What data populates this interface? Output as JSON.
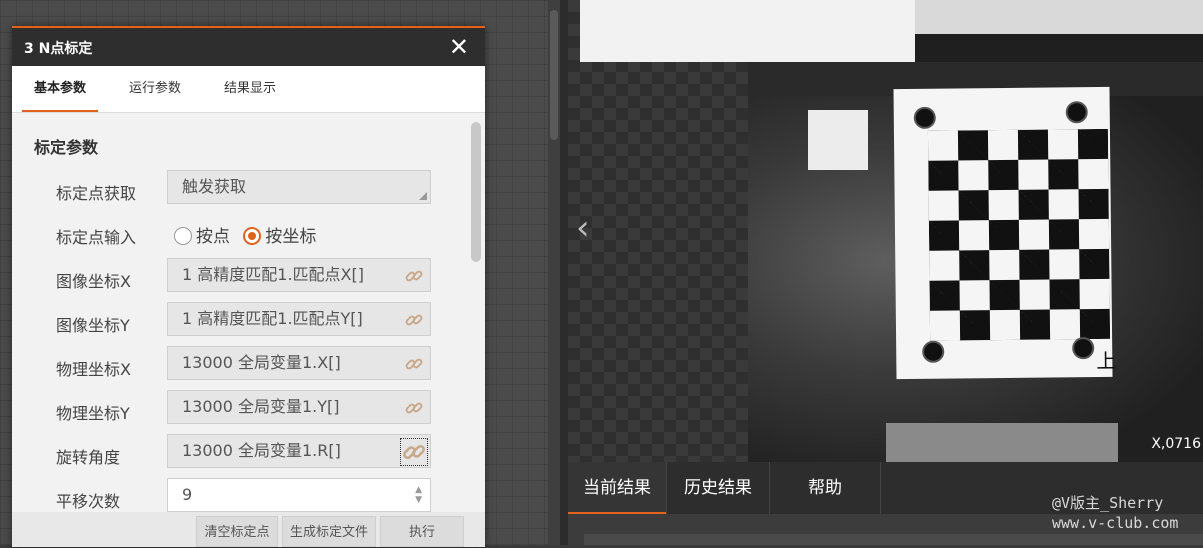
{
  "dialog": {
    "title": "3 N点标定",
    "close_glyph": "✕",
    "tabs": [
      {
        "label": "基本参数",
        "active": true
      },
      {
        "label": "运行参数",
        "active": false
      },
      {
        "label": "结果显示",
        "active": false
      }
    ],
    "section_title": "标定参数",
    "fields": {
      "acquire": {
        "label": "标定点获取",
        "value": "触发获取"
      },
      "input": {
        "label": "标定点输入",
        "options": [
          "按点",
          "按坐标"
        ],
        "selected": "按坐标"
      },
      "image_x": {
        "label": "图像坐标X",
        "value": "1 高精度匹配1.匹配点X[]"
      },
      "image_y": {
        "label": "图像坐标Y",
        "value": "1 高精度匹配1.匹配点Y[]"
      },
      "phys_x": {
        "label": "物理坐标X",
        "value": "13000 全局变量1.X[]"
      },
      "phys_y": {
        "label": "物理坐标Y",
        "value": "13000 全局变量1.Y[]"
      },
      "rotation": {
        "label": "旋转角度",
        "value": "13000 全局变量1.R[]"
      },
      "translate_count": {
        "label": "平移次数",
        "value": "9"
      }
    },
    "footer": {
      "clear_label": "清空标定点",
      "generate_label": "生成标定文件",
      "execute_label": "执行"
    }
  },
  "image_view": {
    "prev_glyph": "‹",
    "coord_text": "X,0716",
    "board_char": "上"
  },
  "result_tabs": [
    {
      "label": "当前结果",
      "active": true
    },
    {
      "label": "历史结果",
      "active": false
    },
    {
      "label": "帮助",
      "active": false
    }
  ],
  "watermark": {
    "line1": "@V版主_Sherry",
    "line2": "www.v-club.com"
  },
  "colors": {
    "accent": "#e2611b",
    "header": "#2e2e2e",
    "panel": "#f2f2f2"
  },
  "icons": {
    "link": "link-icon",
    "close": "close-icon",
    "prev": "chevron-left-icon"
  }
}
